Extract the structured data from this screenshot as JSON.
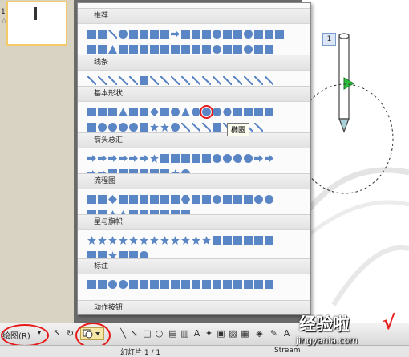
{
  "thumbnail": {
    "slide_number": "1",
    "star": "☆"
  },
  "slide": {
    "number_badge": "1"
  },
  "gallery": {
    "sections": [
      {
        "title": "推荐"
      },
      {
        "title": "线条"
      },
      {
        "title": "基本形状"
      },
      {
        "title": "箭头总汇"
      },
      {
        "title": "流程图"
      },
      {
        "title": "星与旗帜"
      },
      {
        "title": "标注"
      },
      {
        "title": "动作按钮"
      }
    ],
    "tooltip": "椭圆"
  },
  "toolbar": {
    "draw_menu_label": "绘图(R)",
    "cursor_icon": "cursor-icon",
    "autoshape_icon": "autoshape-icon"
  },
  "statusbar": {
    "page_label": "幻灯片 1 / 1",
    "theme_label": "Stream"
  },
  "watermark": {
    "title": "经验啦",
    "check": "√",
    "url": "jingyanla.com"
  },
  "colors": {
    "shape_fill": "#5b86c5",
    "highlight": "#e81818",
    "tooltip_bg": "#fdfdf0"
  }
}
